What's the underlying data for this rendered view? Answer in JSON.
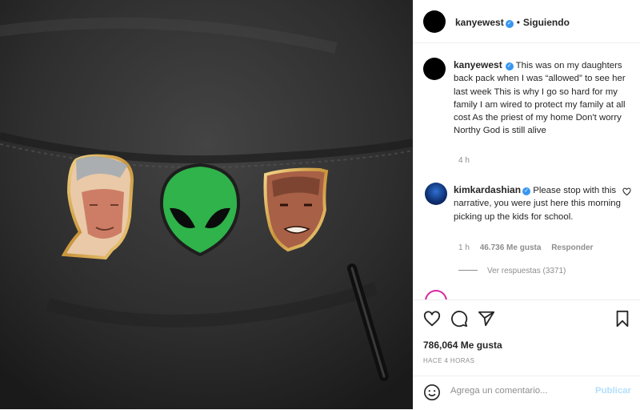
{
  "header": {
    "username": "kanyewest",
    "separator": "•",
    "follow_status": "Siguiendo"
  },
  "caption": {
    "username": "kanyewest",
    "text": "This was on my daughters back pack when I was “allowed” to see her last week This is why I go so hard for my family I am wired to protect my family at all cost As the priest of my home Don't worry Northy God is still alive",
    "age": "4 h"
  },
  "comments": [
    {
      "username": "kimkardashian",
      "text": "Please stop with this narrative, you were just here this morning picking up the kids for school.",
      "age": "1 h",
      "likes": "46.736 Me gusta",
      "reply_label": "Responder",
      "view_replies": "Ver respuestas (3371)"
    }
  ],
  "post": {
    "likes": "786,064 Me gusta",
    "timestamp": "HACE 4 HORAS"
  },
  "add_comment": {
    "placeholder": "Agrega un comentario...",
    "publish_label": "Publicar"
  },
  "icons": {
    "like": "heart-icon",
    "comment": "comment-icon",
    "share": "paper-plane-icon",
    "save": "bookmark-icon",
    "emoji": "emoji-icon",
    "verified": "verified-badge-icon"
  },
  "colors": {
    "verified": "#3897f0",
    "publish": "#b2dffc",
    "muted": "#8e8e8e"
  }
}
